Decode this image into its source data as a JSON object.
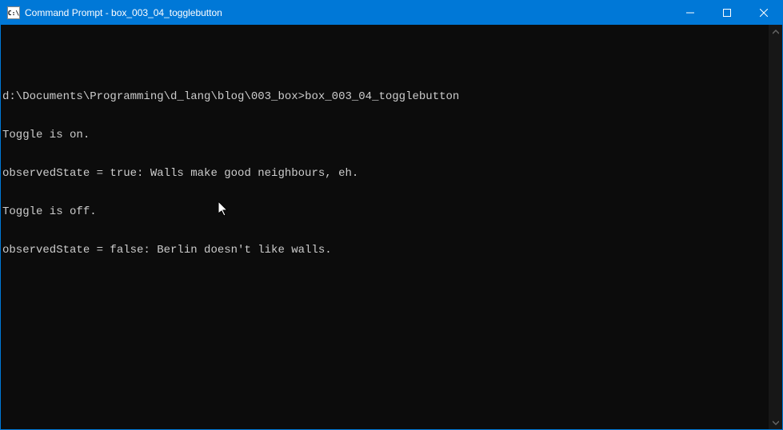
{
  "window": {
    "title": "Command Prompt - box_003_04_togglebutton",
    "icon_label": "C:\\"
  },
  "terminal": {
    "lines": [
      {
        "prompt": "d:\\Documents\\Programming\\d_lang\\blog\\003_box>",
        "command": "box_003_04_togglebutton"
      },
      {
        "text": "Toggle is on."
      },
      {
        "text": "observedState = true: Walls make good neighbours, eh."
      },
      {
        "text": "Toggle is off."
      },
      {
        "text": "observedState = false: Berlin doesn't like walls."
      }
    ]
  }
}
